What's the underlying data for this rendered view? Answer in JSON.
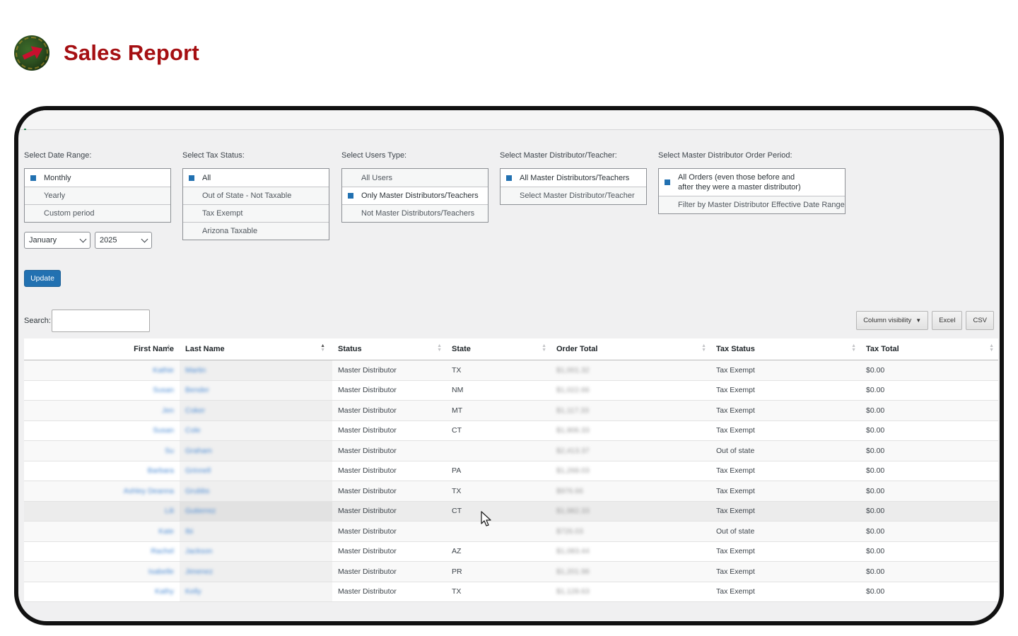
{
  "header": {
    "title": "Sales Report",
    "logo": "company-seal-logo"
  },
  "filters": {
    "date_range": {
      "label": "Select Date Range:",
      "options": [
        {
          "label": "Monthly",
          "selected": true
        },
        {
          "label": "Yearly",
          "selected": false
        },
        {
          "label": "Custom period",
          "selected": false
        }
      ]
    },
    "tax_status": {
      "label": "Select Tax Status:",
      "options": [
        {
          "label": "All",
          "selected": true
        },
        {
          "label": "Out of State - Not Taxable",
          "selected": false
        },
        {
          "label": "Tax Exempt",
          "selected": false
        },
        {
          "label": "Arizona Taxable",
          "selected": false
        }
      ]
    },
    "users_type": {
      "label": "Select Users Type:",
      "options": [
        {
          "label": "All Users",
          "selected": false
        },
        {
          "label": "Only Master Distributors/Teachers",
          "selected": true
        },
        {
          "label": "Not Master Distributors/Teachers",
          "selected": false
        }
      ]
    },
    "master_distributor": {
      "label": "Select Master Distributor/Teacher:",
      "options": [
        {
          "label": "All Master Distributors/Teachers",
          "selected": true
        },
        {
          "label": "Select Master Distributor/Teacher",
          "selected": false
        }
      ]
    },
    "order_period": {
      "label": "Select Master Distributor Order Period:",
      "options": [
        {
          "label": "All Orders (even those before and after they were a master distributor)",
          "selected": true
        },
        {
          "label": "Filter by Master Distributor Effective Date Range",
          "selected": false
        }
      ]
    },
    "month": "January",
    "year": "2025",
    "update_label": "Update"
  },
  "search": {
    "label": "Search:",
    "value": ""
  },
  "toolbar": {
    "column_visibility": "Column visibility",
    "excel": "Excel",
    "csv": "CSV"
  },
  "table": {
    "columns": [
      "First Name",
      "Last Name",
      "Status",
      "State",
      "Order Total",
      "Tax Status",
      "Tax Total"
    ],
    "rows": [
      {
        "first": "Kathie",
        "last": "Martin",
        "status": "Master Distributor",
        "state": "TX",
        "order_total": "$1,001.32",
        "tax_status": "Tax Exempt",
        "tax_total": "$0.00"
      },
      {
        "first": "Susan",
        "last": "Bender",
        "status": "Master Distributor",
        "state": "NM",
        "order_total": "$1,022.66",
        "tax_status": "Tax Exempt",
        "tax_total": "$0.00"
      },
      {
        "first": "Jen",
        "last": "Coker",
        "status": "Master Distributor",
        "state": "MT",
        "order_total": "$1,117.33",
        "tax_status": "Tax Exempt",
        "tax_total": "$0.00"
      },
      {
        "first": "Susan",
        "last": "Cole",
        "status": "Master Distributor",
        "state": "CT",
        "order_total": "$1,906.33",
        "tax_status": "Tax Exempt",
        "tax_total": "$0.00"
      },
      {
        "first": "Su",
        "last": "Graham",
        "status": "Master Distributor",
        "state": "",
        "order_total": "$2,413.37",
        "tax_status": "Out of state",
        "tax_total": "$0.00"
      },
      {
        "first": "Barbara",
        "last": "Grinnell",
        "status": "Master Distributor",
        "state": "PA",
        "order_total": "$1,268.03",
        "tax_status": "Tax Exempt",
        "tax_total": "$0.00"
      },
      {
        "first": "Ashley Deanna",
        "last": "Grubbs",
        "status": "Master Distributor",
        "state": "TX",
        "order_total": "$976.66",
        "tax_status": "Tax Exempt",
        "tax_total": "$0.00"
      },
      {
        "first": "Lili",
        "last": "Gutierrez",
        "status": "Master Distributor",
        "state": "CT",
        "order_total": "$1,982.33",
        "tax_status": "Tax Exempt",
        "tax_total": "$0.00"
      },
      {
        "first": "Kate",
        "last": "Ibi",
        "status": "Master Distributor",
        "state": "",
        "order_total": "$726.03",
        "tax_status": "Out of state",
        "tax_total": "$0.00"
      },
      {
        "first": "Rachel",
        "last": "Jackson",
        "status": "Master Distributor",
        "state": "AZ",
        "order_total": "$1,083.44",
        "tax_status": "Tax Exempt",
        "tax_total": "$0.00"
      },
      {
        "first": "Isabelle",
        "last": "Jimenez",
        "status": "Master Distributor",
        "state": "PR",
        "order_total": "$1,201.98",
        "tax_status": "Tax Exempt",
        "tax_total": "$0.00"
      },
      {
        "first": "Kathy",
        "last": "Kelly",
        "status": "Master Distributor",
        "state": "TX",
        "order_total": "$1,128.63",
        "tax_status": "Tax Exempt",
        "tax_total": "$0.00"
      }
    ]
  }
}
